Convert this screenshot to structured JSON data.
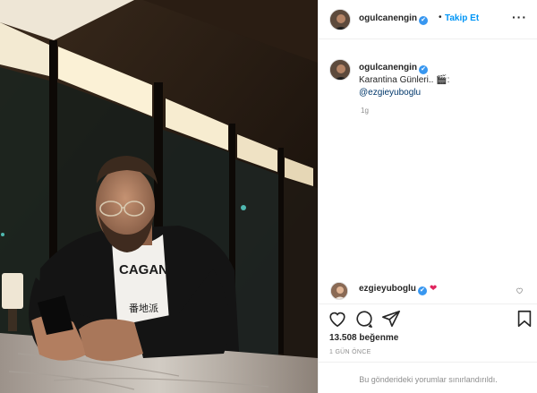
{
  "post": {
    "username": "ogulcanengin",
    "verified_mark": "✔",
    "follow_label": "Takip Et",
    "separator": "•",
    "more_label": "···",
    "caption_text": "Karantina Günleri.. 🎬:",
    "caption_mention": "@ezgieyuboglu",
    "caption_time": "1g",
    "photo_shirt_text": "CAGAN"
  },
  "comment": {
    "username": "ezgieyuboglu",
    "emoji": "❤",
    "like_icon": "heart-outline-icon"
  },
  "actions": {
    "icons": [
      "heart-outline-icon",
      "comment-icon",
      "share-icon",
      "bookmark-icon"
    ]
  },
  "stats": {
    "likes": "13.508 beğenme",
    "date": "1 GÜN ÖNCE"
  },
  "footer": {
    "restricted_text": "Bu gönderideki yorumlar sınırlandırıldı."
  },
  "colors": {
    "accent": "#0095f6",
    "verified": "#3897f0",
    "muted": "#8e8e8e",
    "heart": "#e0245e"
  }
}
